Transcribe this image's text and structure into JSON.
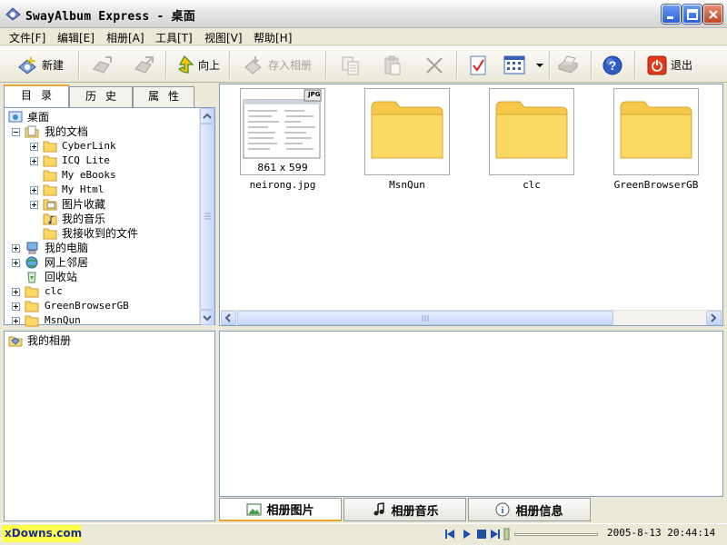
{
  "window": {
    "title": "SwayAlbum Express - 桌面"
  },
  "menu": {
    "items": [
      "文件[F]",
      "编辑[E]",
      "相册[A]",
      "工具[T]",
      "视图[V]",
      "帮助[H]"
    ]
  },
  "toolbar": {
    "new_label": "新建",
    "up_label": "向上",
    "save_to_album_label": "存入相册",
    "exit_label": "退出"
  },
  "left_tabs": [
    "目录",
    "历史",
    "属性"
  ],
  "tree": {
    "desktop": "桌面",
    "my_documents": "我的文档",
    "cyberlink": "CyberLink",
    "icq_lite": "ICQ Lite",
    "my_ebooks": "My eBooks",
    "my_html": "My Html",
    "picture_collection": "图片收藏",
    "my_music": "我的音乐",
    "my_received_files": "我接收到的文件",
    "my_computer": "我的电脑",
    "network_places": "网上邻居",
    "recycle_bin": "回收站",
    "clc": "clc",
    "greenbrowsergb": "GreenBrowserGB",
    "msnqun": "MsnQun"
  },
  "album_panel": {
    "root_label": "我的相册"
  },
  "thumbnails": {
    "items": [
      {
        "name": "neirong.jpg",
        "type": "image",
        "dimensions": "861 x 599",
        "badge": "JPG"
      },
      {
        "name": "MsnQun",
        "type": "folder"
      },
      {
        "name": "clc",
        "type": "folder"
      },
      {
        "name": "GreenBrowserGB",
        "type": "folder"
      }
    ]
  },
  "bottom_tabs": [
    "相册图片",
    "相册音乐",
    "相册信息"
  ],
  "statusbar": {
    "brand": "xDowns.com",
    "datetime": "2005-8-13 20:44:14"
  },
  "colors": {
    "folder_fill": "#fcd864",
    "folder_edge": "#d6a93a",
    "selection_accent": "#e7a534",
    "panel_border": "#7f9db9",
    "brand_bg": "#ffff4e",
    "player_blue": "#1f4fa8"
  }
}
